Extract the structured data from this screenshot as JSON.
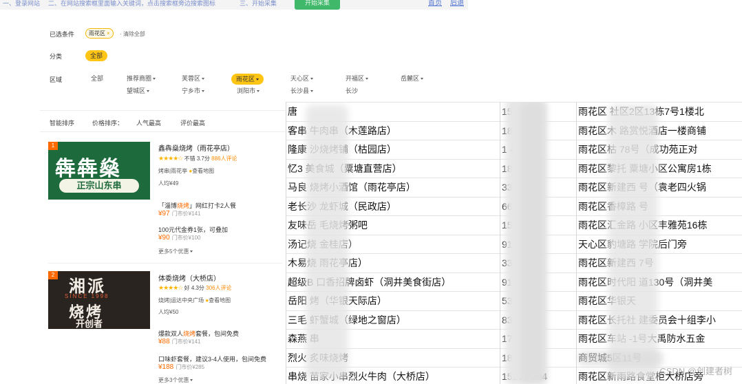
{
  "top_strip": {
    "step1": "一、登录网站",
    "step2": "二、在网站搜索框里面输入关键词，点击搜索框旁边搜索图标",
    "step3": "三、开始采集",
    "start_button": "开始采集",
    "link_home": "首页",
    "link_back": "后退"
  },
  "filters": {
    "selected_label": "已选条件",
    "selected_chip": "雨花区",
    "chip_close": "×",
    "clear_all": "· 清除全部",
    "category_label": "分类",
    "category_all": "全部",
    "area_label": "区域",
    "area_row1": [
      "全部",
      "推荐商圈",
      "芙蓉区",
      "雨花区",
      "天心区",
      "开福区",
      "岳麓区"
    ],
    "area_row2": [
      "望城区",
      "宁乡市",
      "浏阳市",
      "长沙县",
      "长沙"
    ]
  },
  "sort_bar": {
    "smart": "智能排序",
    "price": "价格排序：",
    "popular": "人气最高",
    "rating": "评价最高"
  },
  "listings": [
    {
      "rank": "1",
      "thumb_text_1": "犇犇燊",
      "thumb_text_2": "正宗山东串",
      "title": "鑫犇燊烧烤（雨花亭店）",
      "stars": "★★★★☆",
      "rating_word": "不错",
      "score": "3.7分",
      "reviews": "886人评论",
      "meta": "烤串|雨花亭",
      "map_link": "查看地图",
      "avg_price": "人均¥49",
      "deal1_text": "「淄博烧烤」网红打卡2人餐",
      "deal1_price": "¥97",
      "deal1_store": "门市价¥141",
      "deal2_text": "100元代金券1张，可叠加",
      "deal2_price": "¥90",
      "deal2_store": "门市价¥100",
      "more": "更多5个优惠"
    },
    {
      "rank": "2",
      "thumb_text_1": "湘派",
      "thumb_text_2": "SINCE 1998",
      "thumb_text_3": "烧烤",
      "thumb_text_4": "开创者",
      "title": "体委烧烤（大桥店）",
      "stars": "★★★★☆",
      "rating_word": "好",
      "score": "4.3分",
      "reviews": "306人评论",
      "meta": "烧烤|运达中央广场",
      "map_link": "查看地图",
      "avg_price": "人均¥50",
      "deal1_text": "爆款双人烧烤套餐，包间免费",
      "deal1_price": "¥88",
      "deal1_store": "门市价¥141",
      "deal2_text": "口味虾套餐，建议3-4人使用，包间免费",
      "deal2_price": "¥188",
      "deal2_store": "门市价¥285",
      "more": "更多3个优惠"
    }
  ],
  "sheet": {
    "rows": [
      [
        "唐",
        "159",
        "雨花区 社区2区13栋7号1楼北"
      ],
      [
        "客串 牛肉串（木莲路店）",
        "18",
        "雨花区木 路赏悦酒店一楼商铺"
      ],
      [
        "隆康 沙烧烤铺（枯园店）",
        "1 48",
        "雨花区枯 78号（成功苑正对"
      ],
      [
        "忆3 美食城（粟塘直营店）",
        "18",
        "雨花区黎托 粟塘小区公寓房1栋"
      ],
      [
        "马良 烧烤小酒馆（雨花亭店）",
        "33",
        "雨花区新建西 号（袁老四火锅"
      ],
      [
        "老长沙 龙虾城（民政店）",
        "66",
        "雨花区香樟路 号"
      ],
      [
        "友味岳 毛烧烤粥吧",
        "153 999",
        "雨花区汇金路 小区丰雅苑16栋"
      ],
      [
        "汤记烧 金桂店）",
        "917",
        "天心区豹塘路 学院后门旁"
      ],
      [
        "木易烧 雨花亭店）",
        "33 236",
        "雨花区新建西 7号"
      ],
      [
        "超级B 口香招牌卤虾（洞井美食街店）",
        "917 059",
        "雨花区时代阳 道130号（洞井美"
      ],
      [
        "岳阳 烤（华银天际店）",
        "53 188",
        "雨花区华银天"
      ],
      [
        "三毛 虾蟹城（绿地之窗店）",
        "83 860",
        "雨花区长托社 建委员会十组李小"
      ],
      [
        "森燕 串",
        "177",
        "雨花区车站 -1号大禹防水五金"
      ],
      [
        "烈火 炙味烧烤",
        "1839",
        "商贸城5区11号"
      ],
      [
        "串烧 苗家小串烈火牛肉（大桥店）",
        "15200 384",
        "雨花区新雨路食堂柜大桥店旁"
      ]
    ]
  },
  "watermark": "CSDN @创建者树"
}
